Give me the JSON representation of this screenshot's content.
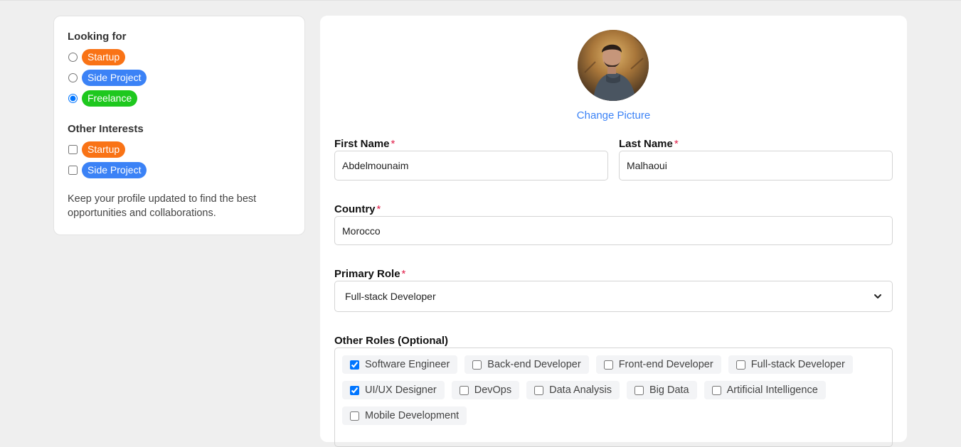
{
  "sidebar": {
    "looking_for_title": "Looking for",
    "looking_for": [
      {
        "label": "Startup",
        "color": "#f97316",
        "selected": false
      },
      {
        "label": "Side Project",
        "color": "#3b82f6",
        "selected": false
      },
      {
        "label": "Freelance",
        "color": "#1ec81e",
        "selected": true
      }
    ],
    "other_interests_title": "Other Interests",
    "other_interests": [
      {
        "label": "Startup",
        "color": "#f97316",
        "checked": false
      },
      {
        "label": "Side Project",
        "color": "#3b82f6",
        "checked": false
      }
    ],
    "note": "Keep your profile updated to find the best opportunities and collaborations."
  },
  "profile": {
    "change_picture": "Change Picture",
    "first_name": {
      "label": "First Name",
      "required": "*",
      "value": "Abdelmounaim"
    },
    "last_name": {
      "label": "Last Name",
      "required": "*",
      "value": "Malhaoui"
    },
    "country": {
      "label": "Country",
      "required": "*",
      "value": "Morocco"
    },
    "primary_role": {
      "label": "Primary Role",
      "required": "*",
      "value": "Full-stack Developer"
    },
    "other_roles": {
      "label": "Other Roles (Optional)",
      "rows": [
        [
          {
            "label": "Software Engineer",
            "checked": true
          },
          {
            "label": "Back-end Developer",
            "checked": false
          },
          {
            "label": "Front-end Developer",
            "checked": false
          },
          {
            "label": "Full-stack Developer",
            "checked": false
          }
        ],
        [
          {
            "label": "UI/UX Designer",
            "checked": true
          },
          {
            "label": "DevOps",
            "checked": false
          },
          {
            "label": "Data Analysis",
            "checked": false
          },
          {
            "label": "Big Data",
            "checked": false
          },
          {
            "label": "Artificial Intelligence",
            "checked": false
          }
        ],
        [
          {
            "label": "Mobile Development",
            "checked": false
          }
        ]
      ]
    }
  },
  "colors": {
    "accent": "#3b82f6",
    "required": "#e11d48"
  }
}
